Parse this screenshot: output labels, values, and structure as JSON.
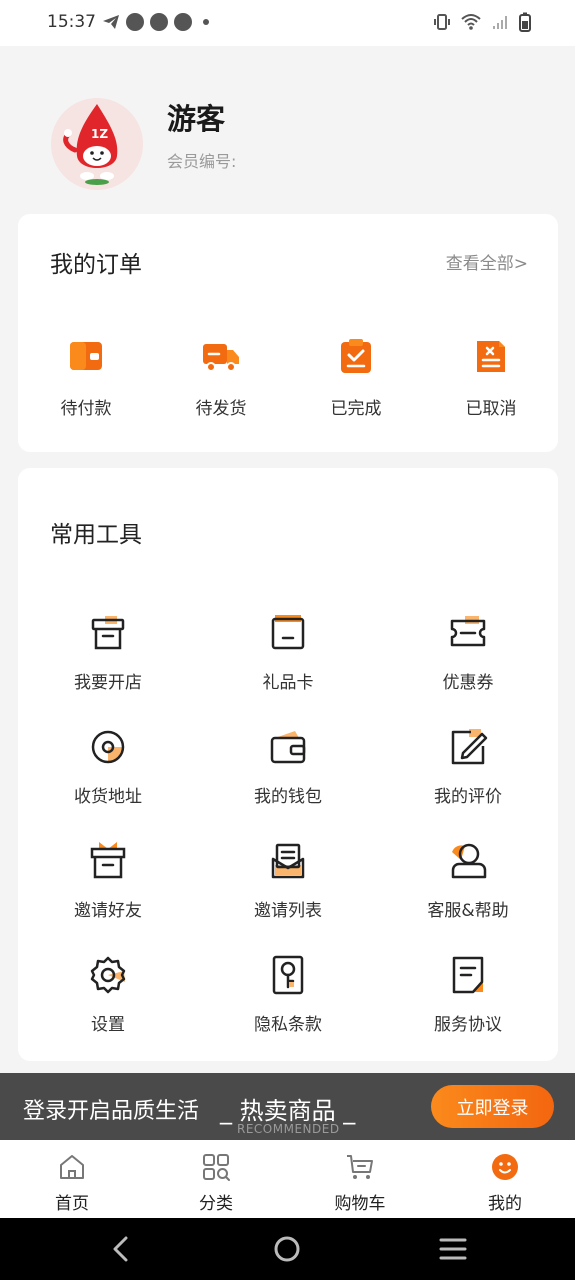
{
  "status_bar": {
    "time": "15:37"
  },
  "profile": {
    "username": "游客",
    "member_no_label": "会员编号:"
  },
  "orders": {
    "title": "我的订单",
    "view_all": "查看全部>",
    "items": [
      {
        "label": "待付款",
        "icon": "wallet-icon"
      },
      {
        "label": "待发货",
        "icon": "truck-icon"
      },
      {
        "label": "已完成",
        "icon": "clipboard-check-icon"
      },
      {
        "label": "已取消",
        "icon": "cancelled-doc-icon"
      }
    ]
  },
  "tools": {
    "title": "常用工具",
    "items": [
      {
        "label": "我要开店",
        "icon": "store-box-icon"
      },
      {
        "label": "礼品卡",
        "icon": "gift-card-icon"
      },
      {
        "label": "优惠券",
        "icon": "coupon-icon"
      },
      {
        "label": "收货地址",
        "icon": "location-icon"
      },
      {
        "label": "我的钱包",
        "icon": "wallet-icon"
      },
      {
        "label": "我的评价",
        "icon": "edit-review-icon"
      },
      {
        "label": "邀请好友",
        "icon": "gift-box-icon"
      },
      {
        "label": "邀请列表",
        "icon": "mail-list-icon"
      },
      {
        "label": "客服&帮助",
        "icon": "customer-service-icon"
      },
      {
        "label": "设置",
        "icon": "gear-icon"
      },
      {
        "label": "隐私条款",
        "icon": "key-doc-icon"
      },
      {
        "label": "服务协议",
        "icon": "agreement-doc-icon"
      }
    ]
  },
  "login_banner": {
    "text": "登录开启品质生活",
    "hot_title": "_ 热卖商品 _",
    "hot_sub": "RECOMMENDED",
    "button": "立即登录"
  },
  "tab_bar": {
    "tabs": [
      {
        "label": "首页",
        "icon": "home-icon"
      },
      {
        "label": "分类",
        "icon": "category-icon"
      },
      {
        "label": "购物车",
        "icon": "cart-icon"
      },
      {
        "label": "我的",
        "icon": "mine-face-icon"
      }
    ]
  },
  "colors": {
    "accent": "#f26b11",
    "accent_light": "#fb8a1c",
    "background": "#f4f4f5",
    "banner": "#4a4a4a"
  }
}
